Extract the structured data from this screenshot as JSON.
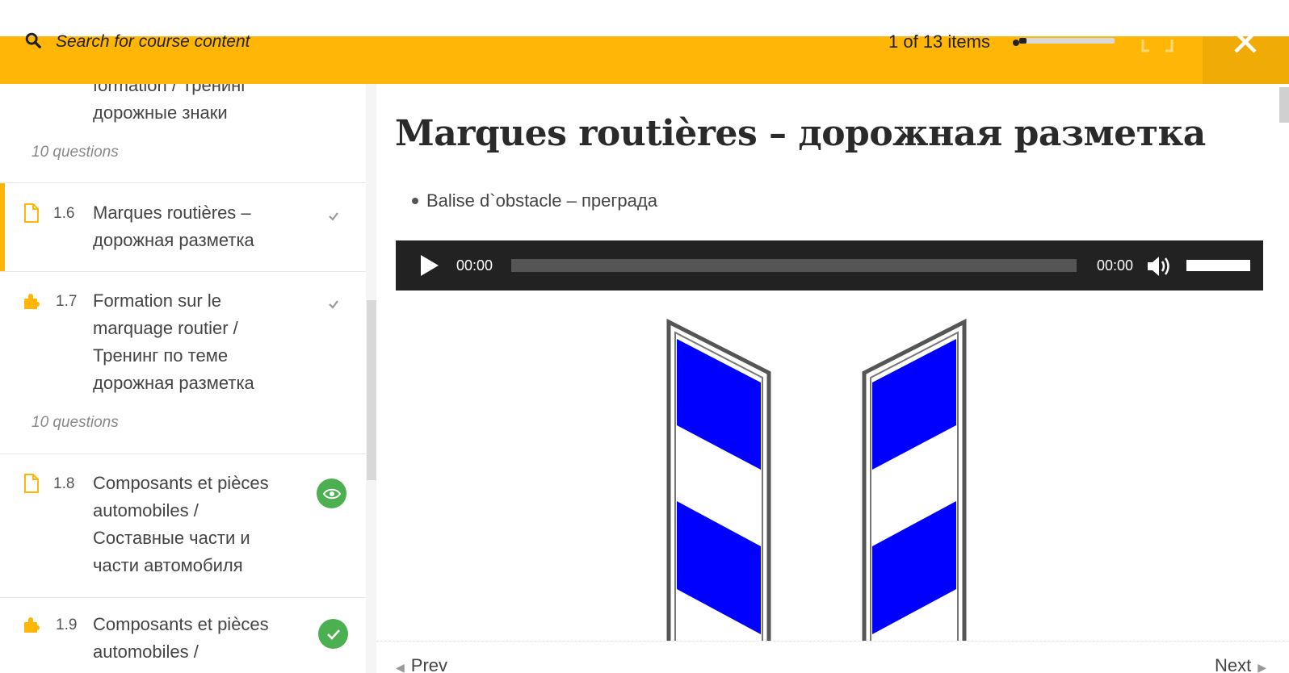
{
  "header": {
    "search_placeholder": "Search for course content",
    "items_count": "1 of 13 items",
    "progress_fraction": 0.08
  },
  "sidebar": {
    "items": [
      {
        "title_lines": [
          "formation / Тренинг",
          "дорожные знаки"
        ],
        "questions": "10 questions"
      },
      {
        "number": "1.6",
        "title_lines": [
          "Marques routières –",
          "дорожная разметка"
        ],
        "status": "completed",
        "active": true
      },
      {
        "number": "1.7",
        "title_lines": [
          "Formation sur le",
          "marquage routier /",
          "Тренинг по теме",
          "дорожная разметка"
        ],
        "questions": "10 questions",
        "status": "completed"
      },
      {
        "number": "1.8",
        "title_lines": [
          "Composants et pièces",
          "automobiles /",
          "Составные части и",
          "части автомобиля"
        ],
        "status": "preview"
      },
      {
        "number": "1.9",
        "title_lines": [
          "Composants et pièces",
          "automobiles /"
        ],
        "status": "passed"
      }
    ]
  },
  "main": {
    "title": "Marques routières – дорожная разметка",
    "bullet": "Balise d`obstacle – преграда",
    "player": {
      "current_time": "00:00",
      "duration": "00:00",
      "volume_level": 1.0
    },
    "nav": {
      "prev": "Prev",
      "next": "Next"
    }
  },
  "colors": {
    "accent": "#ffb606",
    "success": "#4caf50",
    "sign_blue": "#0000ff",
    "player_bg": "#222222"
  }
}
